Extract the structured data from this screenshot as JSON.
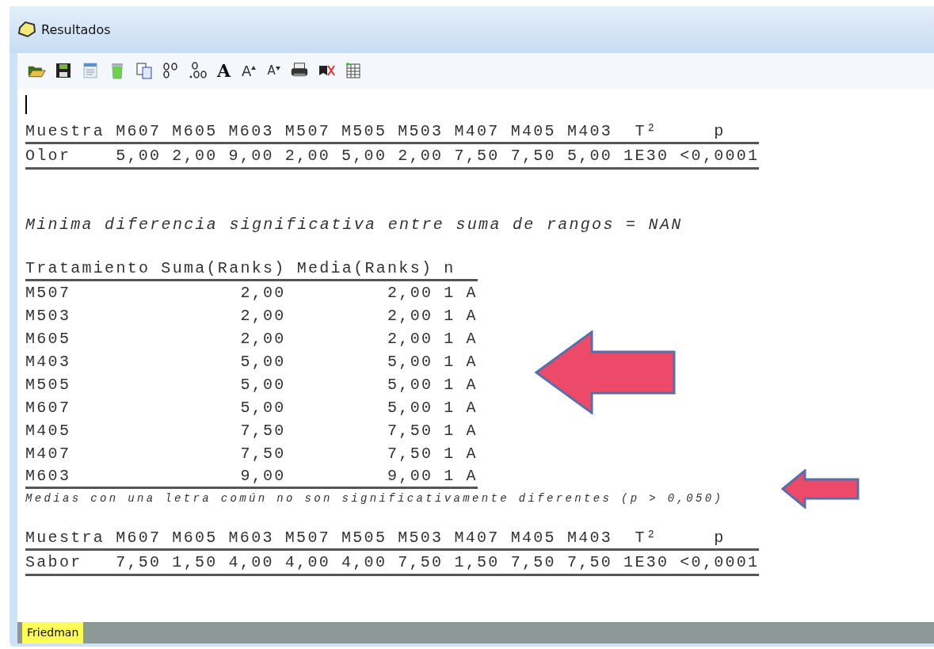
{
  "window": {
    "title": "Resultados"
  },
  "toolbar": [
    {
      "kind": "open"
    },
    {
      "kind": "save"
    },
    {
      "kind": "document"
    },
    {
      "kind": "trash"
    },
    {
      "kind": "copy"
    },
    {
      "kind": "decimals-more"
    },
    {
      "kind": "decimals-less"
    },
    {
      "kind": "font",
      "glyph": "A"
    },
    {
      "kind": "font-up",
      "glyph": "A"
    },
    {
      "kind": "font-down",
      "glyph": "A"
    },
    {
      "kind": "print"
    },
    {
      "kind": "mark"
    },
    {
      "kind": "grid"
    }
  ],
  "sections": [
    {
      "kind": "matrix",
      "columns": [
        "Muestra",
        "M607",
        "M605",
        "M603",
        "M507",
        "M505",
        "M503",
        "M407",
        "M405",
        "M403",
        "T²",
        "p"
      ],
      "rows": [
        [
          "Olor",
          "5,00",
          "2,00",
          "9,00",
          "2,00",
          "5,00",
          "2,00",
          "7,50",
          "7,50",
          "5,00",
          "1E30",
          "<0,0001"
        ]
      ]
    },
    {
      "kind": "heading",
      "text": "Minima diferencia significativa entre suma de rangos = NAN"
    },
    {
      "kind": "ranks",
      "columns": [
        "Tratamiento",
        "Suma(Ranks)",
        "Media(Ranks)",
        "n"
      ],
      "rows": [
        [
          "M507",
          "2,00",
          "2,00",
          "1",
          "A"
        ],
        [
          "M503",
          "2,00",
          "2,00",
          "1",
          "A"
        ],
        [
          "M605",
          "2,00",
          "2,00",
          "1",
          "A"
        ],
        [
          "M403",
          "5,00",
          "5,00",
          "1",
          "A"
        ],
        [
          "M505",
          "5,00",
          "5,00",
          "1",
          "A"
        ],
        [
          "M607",
          "5,00",
          "5,00",
          "1",
          "A"
        ],
        [
          "M405",
          "7,50",
          "7,50",
          "1",
          "A"
        ],
        [
          "M407",
          "7,50",
          "7,50",
          "1",
          "A"
        ],
        [
          "M603",
          "9,00",
          "9,00",
          "1",
          "A"
        ]
      ]
    },
    {
      "kind": "note",
      "text": "Medias con una letra común no son significativamente diferentes (p > 0,050)"
    },
    {
      "kind": "matrix",
      "columns": [
        "Muestra",
        "M607",
        "M605",
        "M603",
        "M507",
        "M505",
        "M503",
        "M407",
        "M405",
        "M403",
        "T²",
        "p"
      ],
      "rows": [
        [
          "Sabor",
          "7,50",
          "1,50",
          "4,00",
          "4,00",
          "4,00",
          "7,50",
          "1,50",
          "7,50",
          "7,50",
          "1E30",
          "<0,0001"
        ]
      ]
    }
  ],
  "tabs": [
    {
      "label": "Friedman",
      "selected": true
    }
  ]
}
